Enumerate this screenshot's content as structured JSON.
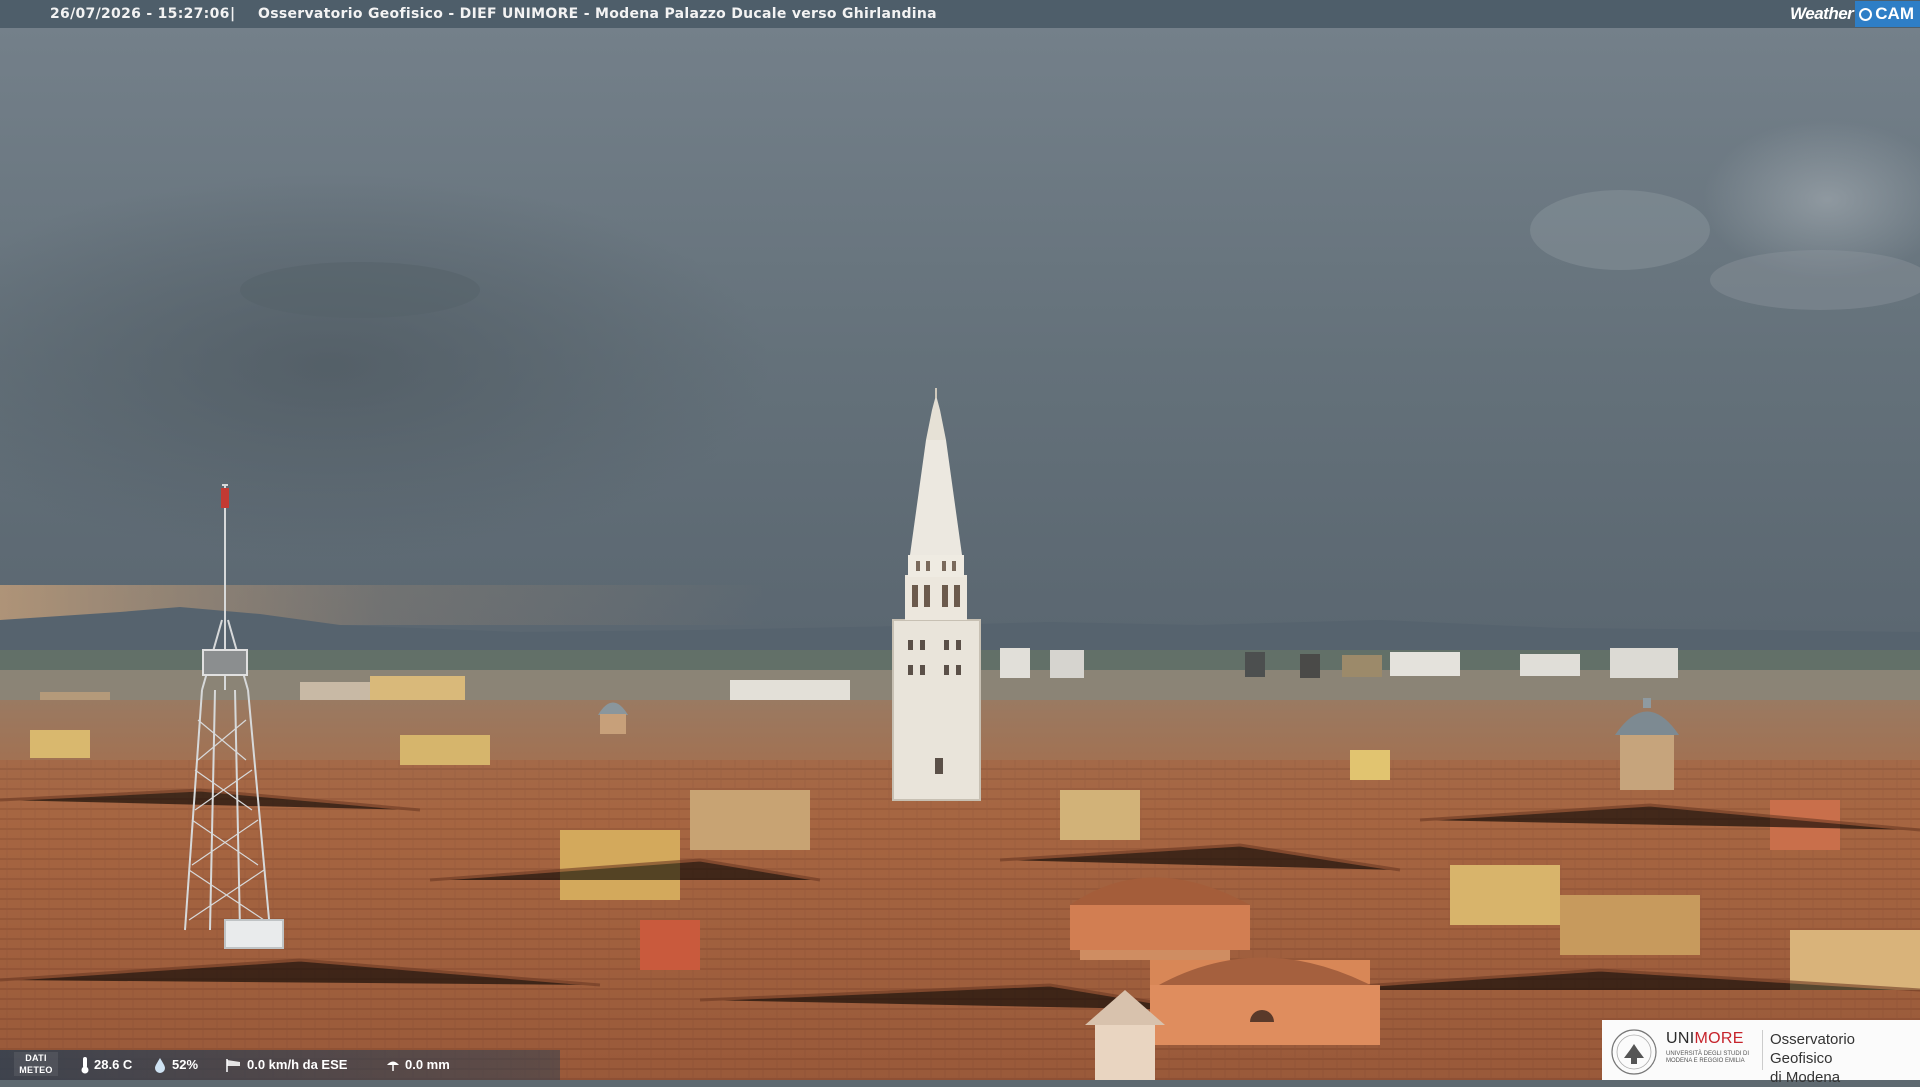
{
  "header": {
    "timestamp": "26/07/2026 - 15:27:06",
    "separator": "|",
    "title": "Osservatorio Geofisico - DIEF UNIMORE - Modena Palazzo Ducale verso Ghirlandina"
  },
  "brand": {
    "weather": "Weather",
    "cam": "CAM",
    "accent": "#2e7ec6"
  },
  "meteo": {
    "label_line1": "DATI",
    "label_line2": "METEO",
    "temperature": "28.6 C",
    "humidity": "52%",
    "wind": "0.0 km/h da ESE",
    "rain": "0.0 mm"
  },
  "logo": {
    "name_a": "UNI",
    "name_b": "MORE",
    "subtitle": "UNIVERSITÀ DEGLI STUDI DI MODENA E REGGIO EMILIA",
    "observatory_line1": "Osservatorio Geofisico",
    "observatory_line2": "di Modena",
    "brand_red": "#c6232b"
  },
  "scene": {
    "sky_color": "#6f7b84",
    "roof_color": "#a4623f",
    "tower_color": "#e8e2d6"
  }
}
